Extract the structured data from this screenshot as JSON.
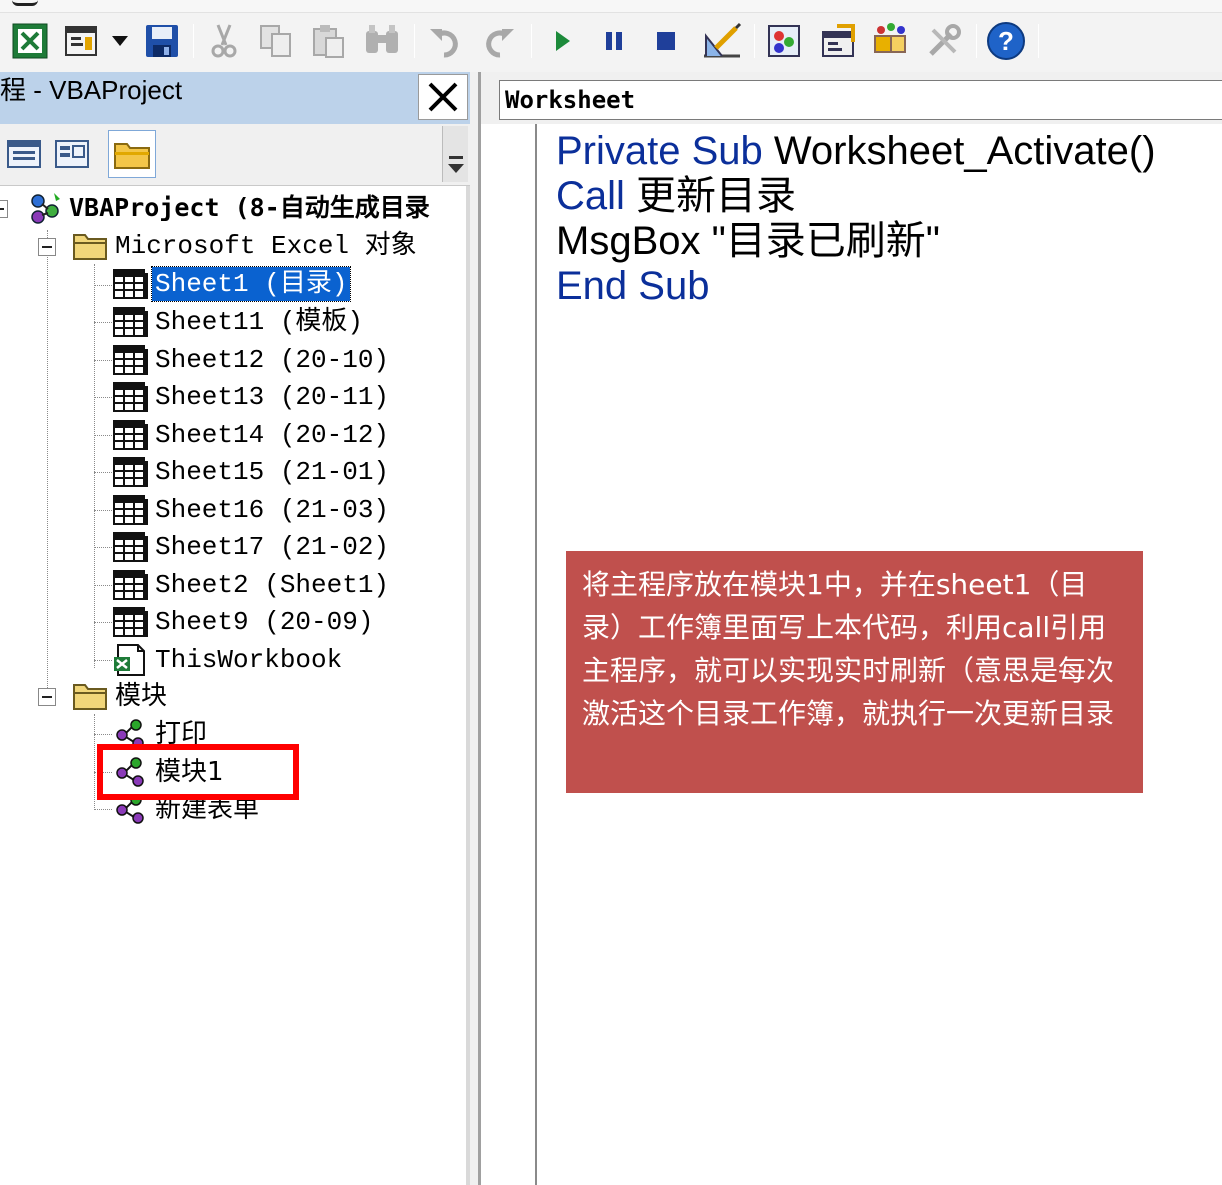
{
  "project_pane": {
    "title": "工程 - VBAProject",
    "close_glyph": "✕"
  },
  "tree": {
    "root_label": "VBAProject (8-自动生成目录",
    "excel_objects_label": "Microsoft Excel 对象",
    "sheets": [
      {
        "label": "Sheet1 (目录)",
        "selected": true
      },
      {
        "label": "Sheet11 (模板)",
        "selected": false
      },
      {
        "label": "Sheet12 (20-10)",
        "selected": false
      },
      {
        "label": "Sheet13 (20-11)",
        "selected": false
      },
      {
        "label": "Sheet14 (20-12)",
        "selected": false
      },
      {
        "label": "Sheet15 (21-01)",
        "selected": false
      },
      {
        "label": "Sheet16 (21-03)",
        "selected": false
      },
      {
        "label": "Sheet17 (21-02)",
        "selected": false
      },
      {
        "label": "Sheet2 (Sheet1)",
        "selected": false
      },
      {
        "label": "Sheet9 (20-09)",
        "selected": false
      }
    ],
    "workbook_label": "ThisWorkbook",
    "modules_label": "模块",
    "modules": [
      {
        "label": "打印"
      },
      {
        "label": "模块1"
      },
      {
        "label": "新建表单"
      }
    ]
  },
  "code_window": {
    "object_combo_value": "Worksheet",
    "code_lines": [
      {
        "kw1": "Private Sub",
        "rest": " Worksheet_Activate()"
      },
      {
        "kw1": "Call",
        "rest": " 更新目录"
      },
      {
        "kw1": "",
        "rest": "MsgBox \"目录已刷新\""
      },
      {
        "kw1": "End Sub",
        "rest": ""
      }
    ]
  },
  "annotation": {
    "text": "将主程序放在模块1中，并在sheet1（目录）工作簿里面写上本代码，利用call引用主程序，就可以实现实时刷新（意思是每次激活这个目录工作簿，就执行一次更新目录"
  },
  "colors": {
    "selection": "#0a62d0",
    "keyword": "#0b2f9a",
    "annotation_bg": "#c0504d",
    "highlight_box": "#ff0000",
    "pane_title_bg": "#bcd2ea"
  },
  "icons": {
    "toolbar": [
      "excel-view-icon",
      "insert-userform-icon",
      "dropdown-arrow-icon",
      "save-icon",
      "cut-icon",
      "copy-icon",
      "paste-icon",
      "find-icon",
      "undo-icon",
      "redo-icon",
      "run-icon",
      "break-icon",
      "reset-icon",
      "design-mode-icon",
      "project-explorer-icon",
      "properties-window-icon",
      "object-browser-icon",
      "toolbox-icon",
      "help-icon"
    ],
    "tree": [
      "vbaproject-icon",
      "folder-icon",
      "worksheet-icon",
      "workbook-icon",
      "module-icon"
    ]
  }
}
